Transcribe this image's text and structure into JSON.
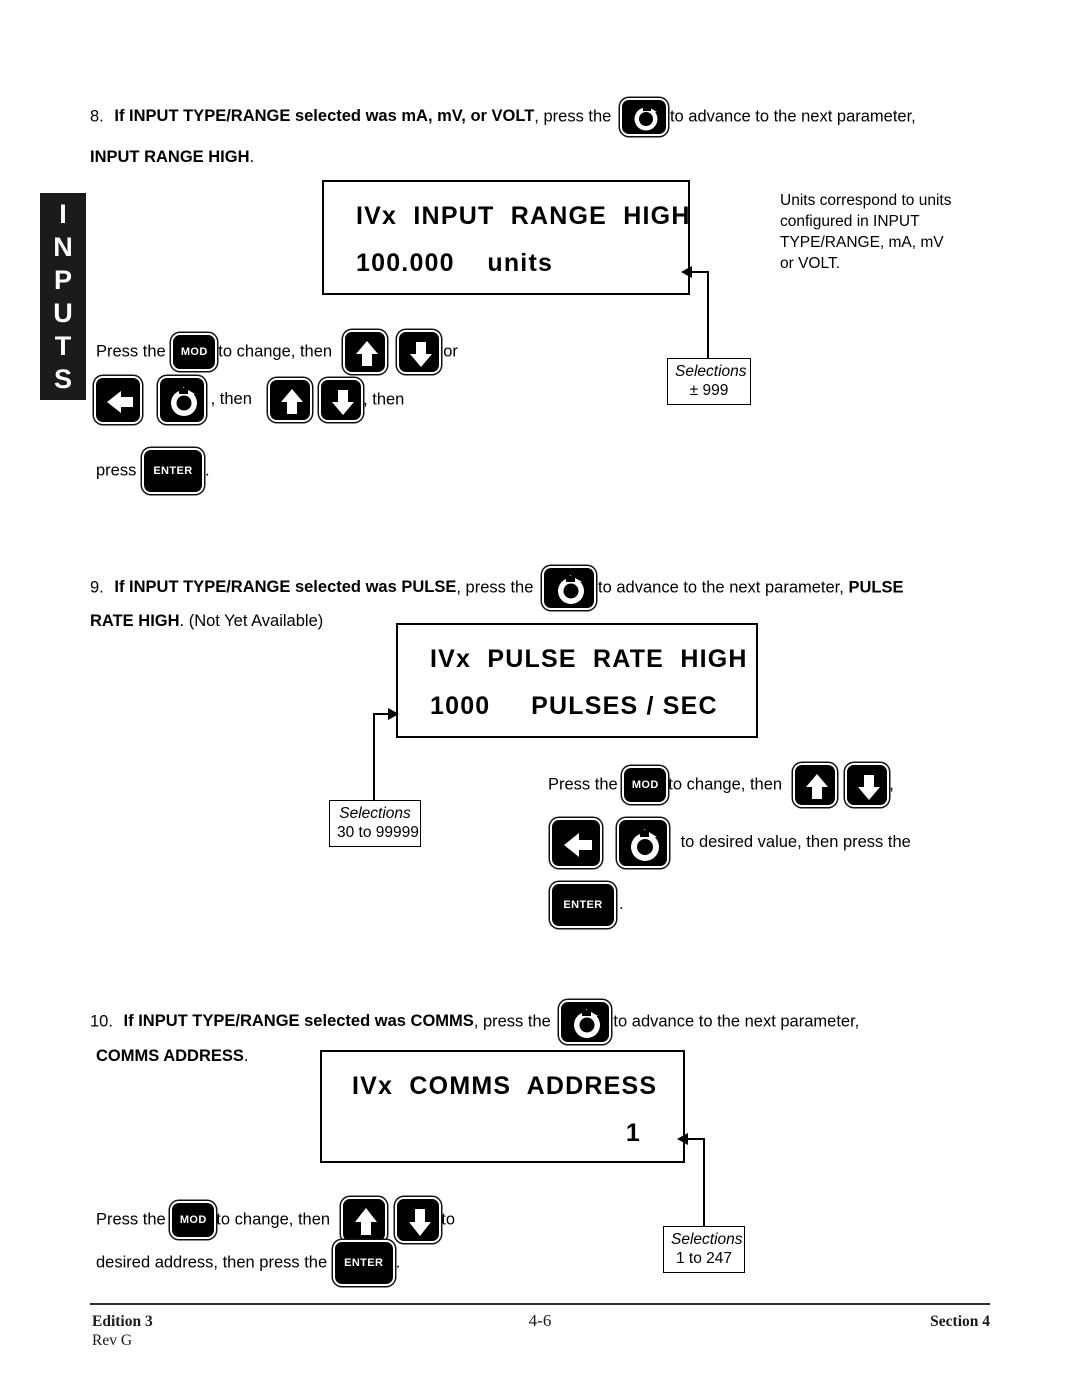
{
  "tab": {
    "label": "INPUTS",
    "letters": [
      "I",
      "N",
      "P",
      "U",
      "T",
      "S"
    ]
  },
  "steps": [
    {
      "number": "8.",
      "text_bold_1": "If INPUT TYPE/RANGE selected was mA, mV, or VOLT",
      "text_1": ", press the",
      "text_2": "to advance to the next parameter,",
      "text_bold_2": "INPUT RANGE HIGH",
      "text_3": "."
    },
    {
      "number": "9.",
      "text_bold_1": "If INPUT TYPE/RANGE selected was PULSE",
      "text_1": ", press the",
      "text_2": "to advance to the next parameter,",
      "text_bold_2": "PULSE",
      "text_bold_3": "RATE HIGH",
      "text_3": ". (Not Yet Available)"
    },
    {
      "number": "10.",
      "text_bold_1": "If INPUT TYPE/RANGE selected was COMMS",
      "text_1": ", press the",
      "text_2": "to advance to the next parameter,",
      "text_bold_2": "COMMS ADDRESS",
      "text_3": "."
    }
  ],
  "displays": [
    {
      "line1": "IVx  INPUT  RANGE  HIGH",
      "line2": "100.000    units",
      "line2_align": "left"
    },
    {
      "line1": "IVx  PULSE  RATE  HIGH",
      "line2": "1000     PULSES / SEC",
      "line2_align": "left"
    },
    {
      "line1": "IVx  COMMS  ADDRESS",
      "line2": "1",
      "line2_align": "right"
    }
  ],
  "note": {
    "lines": [
      "Units correspond to units",
      "configured in  INPUT",
      "TYPE/RANGE, mA, mV",
      "or VOLT."
    ]
  },
  "selections": [
    {
      "title": "Selections",
      "value": "± 999"
    },
    {
      "title": "Selections",
      "value": "30 to 99999"
    },
    {
      "title": "Selections",
      "value": "1 to 247"
    }
  ],
  "instructions": {
    "block1": {
      "l1_a": "Press the",
      "l1_b": "to  change,  then",
      "l1_c": "or",
      "l2_a": ", then",
      "l2_b": ", then",
      "l3_a": "press",
      "l3_b": "."
    },
    "block2": {
      "l1_a": "Press  the",
      "l1_b": "to change, then",
      "l1_c": ",",
      "l2_a": "to desired value, then press the",
      "l3_a": "."
    },
    "block3": {
      "l1_a": "Press the",
      "l1_b": "to change, then",
      "l1_c": "to",
      "l2_a": "desired address, then press the",
      "l2_b": "."
    }
  },
  "buttons": {
    "mod": "MOD",
    "enter": "ENTER",
    "up": "up-arrow",
    "down": "down-arrow",
    "left": "left-arrow",
    "advance": "rotate-advance"
  },
  "footer": {
    "edition": "Edition 3",
    "rev": "Rev G",
    "page": "4-6",
    "section": "Section 4"
  },
  "colors": {
    "ink": "#000000",
    "paper": "#ffffff",
    "tab_bg": "#1b1b1b"
  }
}
